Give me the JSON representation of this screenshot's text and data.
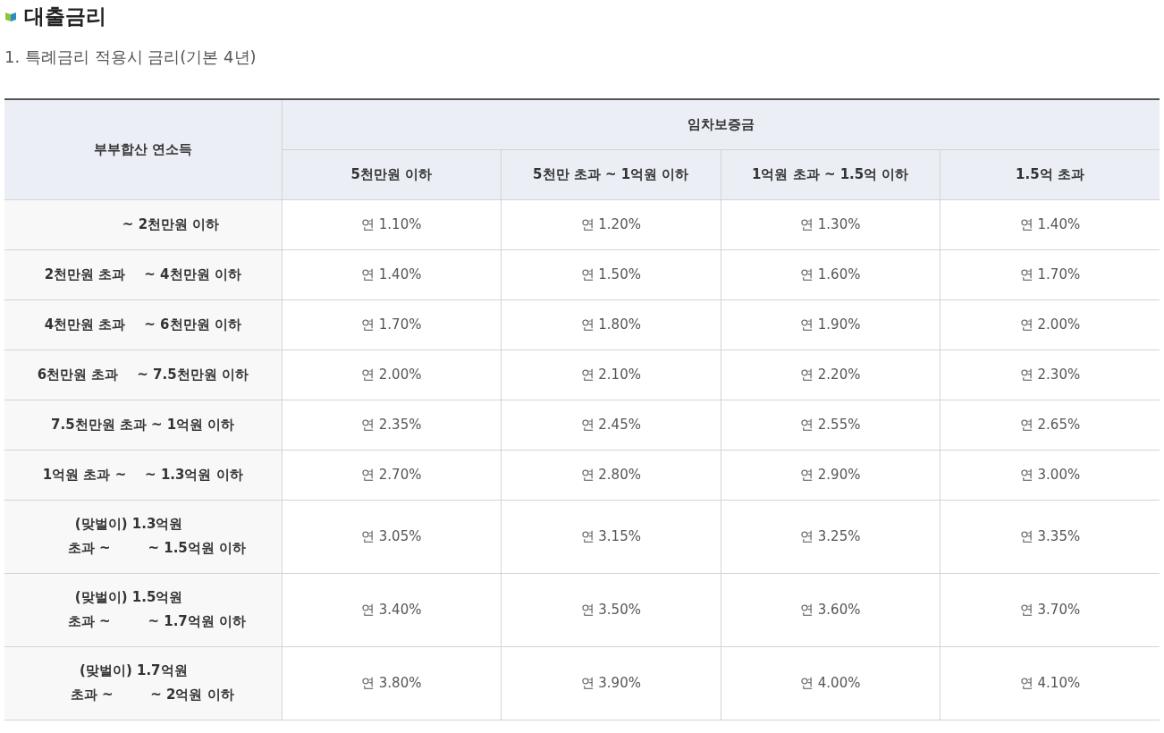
{
  "heading": "대출금리",
  "subheading": "1. 특례금리 적용시 금리(기본 4년)",
  "table": {
    "row_header": "부부합산 연소득",
    "group_header": "임차보증금",
    "columns": [
      "5천만원 이하",
      "5천만 초과 ~ 1억원 이하",
      "1억원 초과 ~ 1.5억 이하",
      "1.5억 초과"
    ],
    "rows": [
      {
        "label": [
          "            ~ 2천만원 이하"
        ],
        "cells": [
          "연 1.10%",
          "연 1.20%",
          "연 1.30%",
          "연 1.40%"
        ]
      },
      {
        "label": [
          "2천만원 초과    ~ 4천만원 이하"
        ],
        "cells": [
          "연 1.40%",
          "연 1.50%",
          "연 1.60%",
          "연 1.70%"
        ]
      },
      {
        "label": [
          "4천만원 초과    ~ 6천만원 이하"
        ],
        "cells": [
          "연 1.70%",
          "연 1.80%",
          "연 1.90%",
          "연 2.00%"
        ]
      },
      {
        "label": [
          "6천만원 초과    ~ 7.5천만원 이하"
        ],
        "cells": [
          "연 2.00%",
          "연 2.10%",
          "연 2.20%",
          "연 2.30%"
        ]
      },
      {
        "label": [
          "7.5천만원 초과 ~ 1억원 이하"
        ],
        "cells": [
          "연 2.35%",
          "연 2.45%",
          "연 2.55%",
          "연 2.65%"
        ]
      },
      {
        "label": [
          "1억원 초과 ~    ~ 1.3억원 이하"
        ],
        "cells": [
          "연 2.70%",
          "연 2.80%",
          "연 2.90%",
          "연 3.00%"
        ]
      },
      {
        "label": [
          "(맞벌이) 1.3억원      ",
          "      초과 ~        ~ 1.5억원 이하"
        ],
        "cells": [
          "연 3.05%",
          "연 3.15%",
          "연 3.25%",
          "연 3.35%"
        ]
      },
      {
        "label": [
          "(맞벌이) 1.5억원      ",
          "      초과 ~        ~ 1.7억원 이하"
        ],
        "cells": [
          "연 3.40%",
          "연 3.50%",
          "연 3.60%",
          "연 3.70%"
        ]
      },
      {
        "label": [
          "(맞벌이) 1.7억원    ",
          "    초과 ~        ~ 2억원 이하"
        ],
        "cells": [
          "연 3.80%",
          "연 3.90%",
          "연 4.00%",
          "연 4.10%"
        ]
      }
    ]
  }
}
